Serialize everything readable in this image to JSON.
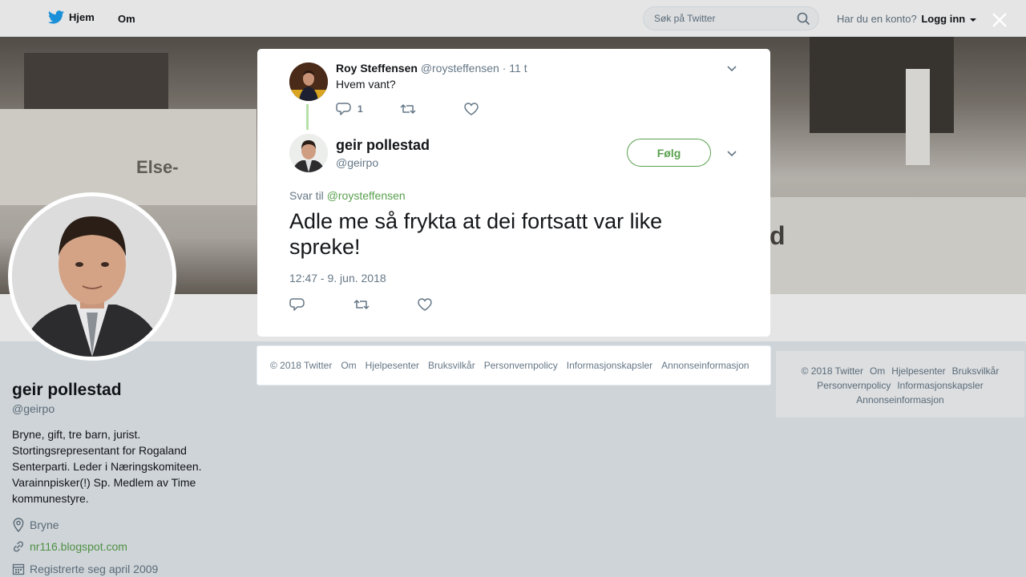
{
  "nav": {
    "home_label": "Hjem",
    "about_label": "Om",
    "search_placeholder": "Søk på Twitter",
    "account_prompt": "Har du en konto?",
    "login_label": "Logg inn"
  },
  "banner": {
    "text_left": "Else-",
    "text_right": "d"
  },
  "profile": {
    "name": "geir pollestad",
    "handle": "@geirpo",
    "bio": "Bryne, gift, tre barn, jurist. Stortingsrepresentant for Rogaland Senterparti. Leder i Næringskomiteen. Varainnpisker(!) Sp. Medlem av Time kommunestyre.",
    "location": "Bryne",
    "website": "nr116.blogspot.com",
    "joined": "Registrerte seg april 2009"
  },
  "parent_tweet": {
    "name": "Roy Steffensen",
    "handle": "@roysteffensen",
    "time": "· 11 t",
    "text": "Hvem vant?",
    "reply_count": "1"
  },
  "main_tweet": {
    "name": "geir pollestad",
    "handle": "@geirpo",
    "follow_label": "Følg",
    "reply_prefix": "Svar til",
    "reply_to": "@roysteffensen",
    "text": "Adle me så frykta at dei fortsatt var like spreke!",
    "timestamp": "12:47 - 9. jun. 2018"
  },
  "footer_items": [
    "© 2018 Twitter",
    "Om",
    "Hjelpesenter",
    "Bruksvilkår",
    "Personvernpolicy",
    "Informasjonskapsler",
    "Annonseinformasjon"
  ],
  "colors": {
    "accent": "#5aa14f",
    "twitter_blue": "#1da1f2",
    "thread_line": "#b7e0a9"
  }
}
